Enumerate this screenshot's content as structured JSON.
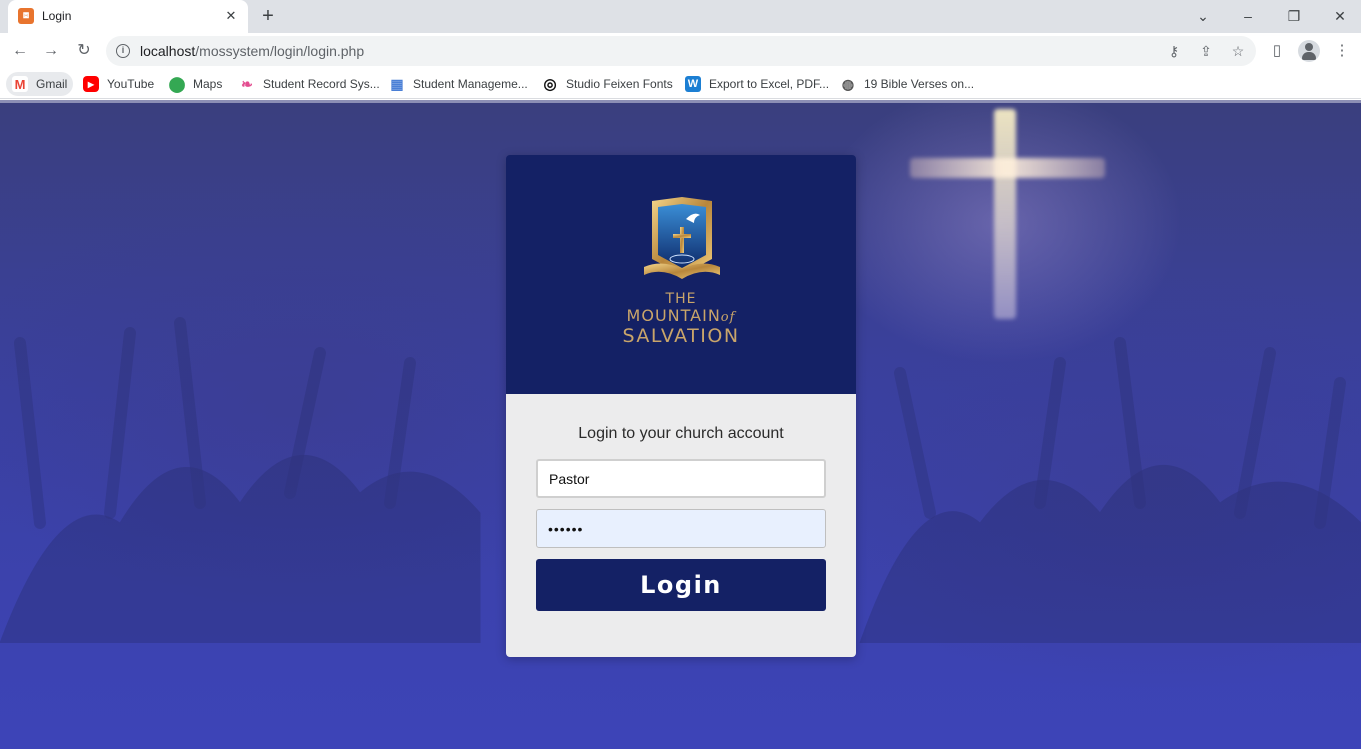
{
  "browser": {
    "tab_title": "Login",
    "new_tab_symbol": "+",
    "url_host": "localhost",
    "url_path": "/mossystem/login/login.php"
  },
  "bookmarks": [
    {
      "label": "Gmail",
      "icon": "gmail-icon",
      "color": "#ea4335"
    },
    {
      "label": "YouTube",
      "icon": "youtube-icon",
      "color": "#ff0000"
    },
    {
      "label": "Maps",
      "icon": "maps-icon",
      "color": "#34a853"
    },
    {
      "label": "Student Record Sys...",
      "icon": "book-icon",
      "color": "#e34c8f"
    },
    {
      "label": "Student Manageme...",
      "icon": "school-icon",
      "color": "#4a7fd6"
    },
    {
      "label": "Studio Feixen Fonts",
      "icon": "target-icon",
      "color": "#111111"
    },
    {
      "label": "Export to Excel, PDF...",
      "icon": "w-icon",
      "color": "#1c7fd3"
    },
    {
      "label": "19 Bible Verses on...",
      "icon": "globe-icon",
      "color": "#555555"
    }
  ],
  "brand": {
    "line1": "THE",
    "line2": "MOUNTAIN",
    "line2_suffix": "of",
    "line3": "SALVATION"
  },
  "login": {
    "heading": "Login to your church account",
    "username_value": "Pastor",
    "password_value": "••••••",
    "button_label": "Login"
  },
  "colors": {
    "primary": "#142165",
    "card_body": "#ececed",
    "brand_gold": "#c9a56a"
  }
}
